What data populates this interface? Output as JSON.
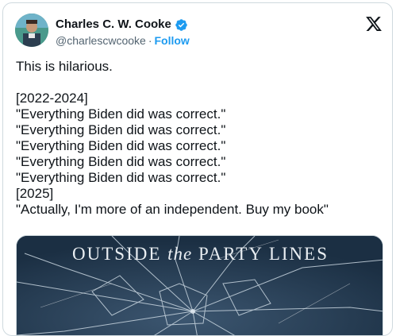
{
  "author": {
    "display_name": "Charles C. W. Cooke",
    "handle": "@charlescwcooke",
    "separator": "·",
    "follow_label": "Follow",
    "verified_icon": "verified-badge-icon",
    "avatar_icon": "avatar"
  },
  "platform": {
    "logo_icon": "x-logo-icon"
  },
  "tweet": {
    "line_1": "This is hilarious.",
    "line_2": "[2022-2024]",
    "line_3": "\"Everything Biden did was correct.\"",
    "line_4": "\"Everything Biden did was correct.\"",
    "line_5": "\"Everything Biden did was correct.\"",
    "line_6": "\"Everything Biden did was correct.\"",
    "line_7": "\"Everything Biden did was correct.\"",
    "line_8": "[2025]",
    "line_9": "\"Actually, I'm more of an independent. Buy my book\""
  },
  "media": {
    "title_part_1": "OUTSIDE ",
    "title_part_2": "the",
    "title_part_3": " PARTY LINES"
  },
  "colors": {
    "text_primary": "#0f1419",
    "text_secondary": "#536471",
    "accent_blue": "#1d9bf0",
    "border": "#cfd9de",
    "cover_bg": "#20364b"
  }
}
